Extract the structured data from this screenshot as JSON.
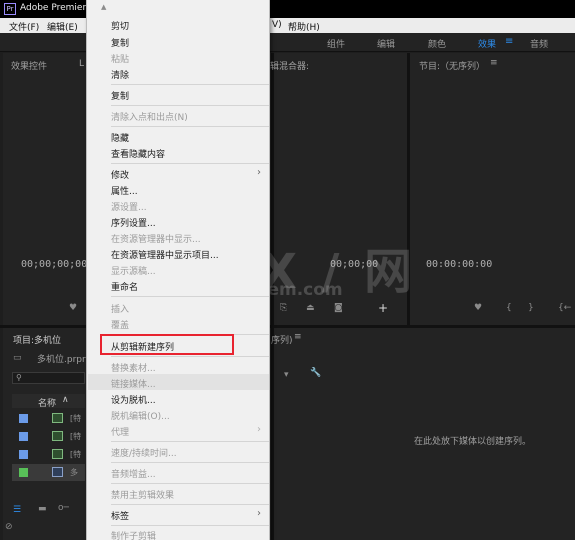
{
  "app": {
    "title": "Adobe Premier",
    "icon": "Pr"
  },
  "menubar": {
    "file": "文件(F)",
    "edit": "编辑(E)",
    "clip_partial": "V)",
    "help": "帮助(H)"
  },
  "workspaces": {
    "assembly": "组件",
    "editing": "编辑",
    "color": "颜色",
    "effects": "效果",
    "menu": "≡",
    "audio": "音频"
  },
  "panels": {
    "effect_controls": "效果控件",
    "effect_controls_tab_partial": "L",
    "audio_mixer": "辑混合器:",
    "program": "节目:（无序列）",
    "program_menu": "≡",
    "source_tc": "00;00;00;00",
    "mid_tc": "00;00;00",
    "program_tc": "00:00:00:00",
    "project": "项目:多机位",
    "project_file": "多机位.prpro",
    "timeline": "序列)",
    "timeline_menu": "≡",
    "timeline_hint": "在此处放下媒体以创建序列。",
    "name_col": "名称",
    "rows": [
      {
        "label": "[特",
        "color": "#6b9be8"
      },
      {
        "label": "[特",
        "color": "#6b9be8"
      },
      {
        "label": "[特",
        "color": "#6b9be8"
      },
      {
        "label": "多",
        "color": "#58c058"
      }
    ]
  },
  "context_menu": {
    "items": [
      {
        "label": "剪切",
        "disabled": false
      },
      {
        "label": "复制",
        "disabled": false
      },
      {
        "label": "粘贴",
        "disabled": true
      },
      {
        "label": "清除",
        "disabled": false
      },
      {
        "label": "复制",
        "disabled": false
      },
      {
        "label": "清除入点和出点(N)",
        "disabled": true
      },
      {
        "label": "隐藏",
        "disabled": false
      },
      {
        "label": "查看隐藏内容",
        "disabled": false
      },
      {
        "label": "修改",
        "disabled": false
      },
      {
        "label": "属性...",
        "disabled": false
      },
      {
        "label": "源设置...",
        "disabled": true
      },
      {
        "label": "序列设置...",
        "disabled": false
      },
      {
        "label": "在资源管理器中显示...",
        "disabled": true
      },
      {
        "label": "在资源管理器中显示项目...",
        "disabled": false
      },
      {
        "label": "显示源稿...",
        "disabled": true
      },
      {
        "label": "重命名",
        "disabled": false
      },
      {
        "label": "插入",
        "disabled": true
      },
      {
        "label": "覆盖",
        "disabled": true
      },
      {
        "label": "从剪辑新建序列",
        "disabled": false
      },
      {
        "label": "替换素材...",
        "disabled": true
      },
      {
        "label": "链接媒体...",
        "disabled": true
      },
      {
        "label": "设为脱机...",
        "disabled": false
      },
      {
        "label": "脱机编辑(O)...",
        "disabled": true
      },
      {
        "label": "代理",
        "disabled": true
      },
      {
        "label": "速度/持续时间...",
        "disabled": true
      },
      {
        "label": "音频增益...",
        "disabled": true
      },
      {
        "label": "禁用主剪辑效果",
        "disabled": true
      },
      {
        "label": "标签",
        "disabled": false
      },
      {
        "label": "制作子剪辑",
        "disabled": true
      }
    ],
    "submenu_arrow": "›"
  },
  "watermark": {
    "main": "G X / 网",
    "sub": "system.com"
  },
  "colors": {
    "accent": "#2d8ceb",
    "highlight": "#e8232f"
  }
}
